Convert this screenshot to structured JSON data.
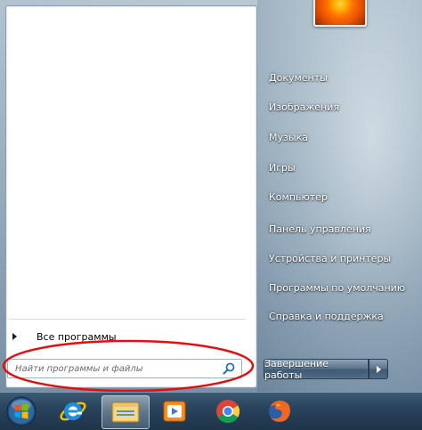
{
  "start_menu": {
    "all_programs_label": "Все программы",
    "search": {
      "placeholder": "Найти программы и файлы",
      "value": ""
    },
    "right_pane": {
      "items": [
        {
          "label": "Документы"
        },
        {
          "label": "Изображения"
        },
        {
          "label": "Музыка"
        },
        {
          "label": "Игры"
        },
        {
          "label": "Компьютер"
        },
        {
          "label": "Панель управления"
        },
        {
          "label": "Устройства и принтеры"
        },
        {
          "label": "Программы по умолчанию"
        },
        {
          "label": "Справка и поддержка"
        }
      ]
    },
    "shutdown_label": "Завершение работы"
  },
  "taskbar": {
    "items": [
      {
        "icon": "windows-start-orb-icon"
      },
      {
        "icon": "internet-explorer-icon"
      },
      {
        "icon": "windows-explorer-icon"
      },
      {
        "icon": "media-player-icon"
      },
      {
        "icon": "chrome-icon"
      },
      {
        "icon": "firefox-icon"
      }
    ]
  },
  "colors": {
    "annotation": "#e01010",
    "search_icon": "#2a6fb5"
  }
}
